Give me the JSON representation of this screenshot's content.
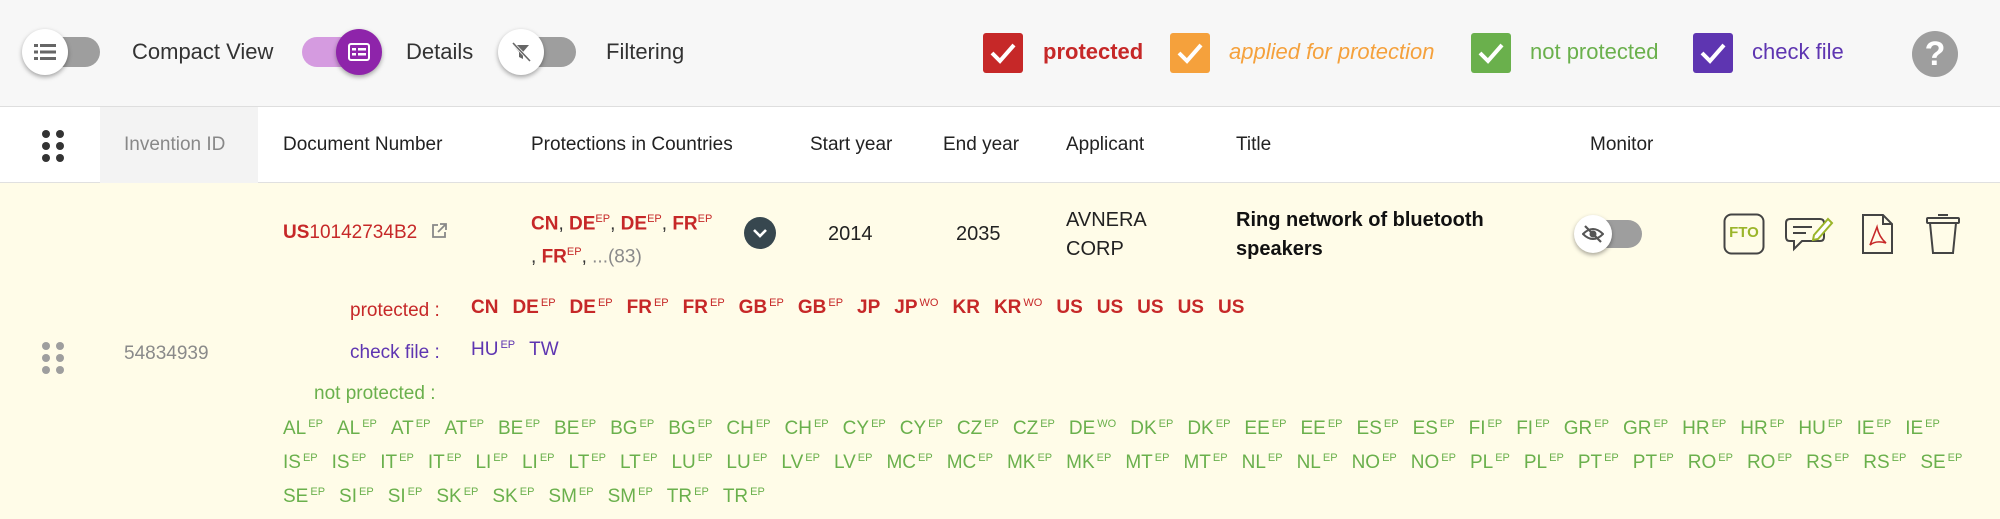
{
  "toolbar": {
    "compact_view_label": "Compact View",
    "details_label": "Details",
    "filtering_label": "Filtering",
    "legend": [
      {
        "label": "protected",
        "color": "#c62828"
      },
      {
        "label": "applied for protection",
        "color": "#f5a13c"
      },
      {
        "label": "not protected",
        "color": "#6ab04c"
      },
      {
        "label": "check file",
        "color": "#5e35b1"
      }
    ],
    "help_label": "?"
  },
  "columns": {
    "invention_id": "Invention ID",
    "document_number": "Document Number",
    "protections": "Protections in Countries",
    "start_year": "Start year",
    "end_year": "End year",
    "applicant": "Applicant",
    "title": "Title",
    "monitor": "Monitor"
  },
  "row": {
    "invention_id": "54834939",
    "doc_prefix": "US",
    "doc_number": "10142734B2",
    "summary": {
      "line1": [
        {
          "code": "CN",
          "sup": ""
        },
        {
          "code": "DE",
          "sup": "EP"
        },
        {
          "code": "DE",
          "sup": "EP"
        },
        {
          "code": "FR",
          "sup": "EP"
        }
      ],
      "line2": [
        {
          "code": "FR",
          "sup": "EP"
        }
      ],
      "more": "...(83)",
      "separator": ","
    },
    "start_year": "2014",
    "end_year": "2035",
    "applicant_line1": "AVNERA",
    "applicant_line2": "CORP",
    "title_line1": "Ring network of bluetooth",
    "title_line2": "speakers",
    "actions": {
      "fto": "FTO"
    },
    "protected_label": "protected :",
    "protected": [
      {
        "code": "CN",
        "sup": ""
      },
      {
        "code": "DE",
        "sup": "EP"
      },
      {
        "code": "DE",
        "sup": "EP"
      },
      {
        "code": "FR",
        "sup": "EP"
      },
      {
        "code": "FR",
        "sup": "EP"
      },
      {
        "code": "GB",
        "sup": "EP"
      },
      {
        "code": "GB",
        "sup": "EP"
      },
      {
        "code": "JP",
        "sup": ""
      },
      {
        "code": "JP",
        "sup": "WO"
      },
      {
        "code": "KR",
        "sup": ""
      },
      {
        "code": "KR",
        "sup": "WO"
      },
      {
        "code": "US",
        "sup": ""
      },
      {
        "code": "US",
        "sup": ""
      },
      {
        "code": "US",
        "sup": ""
      },
      {
        "code": "US",
        "sup": ""
      },
      {
        "code": "US",
        "sup": ""
      }
    ],
    "check_file_label": "check file :",
    "check_file": [
      {
        "code": "HU",
        "sup": "EP"
      },
      {
        "code": "TW",
        "sup": ""
      }
    ],
    "not_protected_label": "not protected :",
    "not_protected": [
      {
        "code": "AL",
        "sup": "EP"
      },
      {
        "code": "AL",
        "sup": "EP"
      },
      {
        "code": "AT",
        "sup": "EP"
      },
      {
        "code": "AT",
        "sup": "EP"
      },
      {
        "code": "BE",
        "sup": "EP"
      },
      {
        "code": "BE",
        "sup": "EP"
      },
      {
        "code": "BG",
        "sup": "EP"
      },
      {
        "code": "BG",
        "sup": "EP"
      },
      {
        "code": "CH",
        "sup": "EP"
      },
      {
        "code": "CH",
        "sup": "EP"
      },
      {
        "code": "CY",
        "sup": "EP"
      },
      {
        "code": "CY",
        "sup": "EP"
      },
      {
        "code": "CZ",
        "sup": "EP"
      },
      {
        "code": "CZ",
        "sup": "EP"
      },
      {
        "code": "DE",
        "sup": "WO"
      },
      {
        "code": "DK",
        "sup": "EP"
      },
      {
        "code": "DK",
        "sup": "EP"
      },
      {
        "code": "EE",
        "sup": "EP"
      },
      {
        "code": "EE",
        "sup": "EP"
      },
      {
        "code": "ES",
        "sup": "EP"
      },
      {
        "code": "ES",
        "sup": "EP"
      },
      {
        "code": "FI",
        "sup": "EP"
      },
      {
        "code": "FI",
        "sup": "EP"
      },
      {
        "code": "GR",
        "sup": "EP"
      },
      {
        "code": "GR",
        "sup": "EP"
      },
      {
        "code": "HR",
        "sup": "EP"
      },
      {
        "code": "HR",
        "sup": "EP"
      },
      {
        "code": "HU",
        "sup": "EP"
      },
      {
        "code": "IE",
        "sup": "EP"
      },
      {
        "code": "IE",
        "sup": "EP"
      },
      {
        "code": "IS",
        "sup": "EP"
      },
      {
        "code": "IS",
        "sup": "EP"
      },
      {
        "code": "IT",
        "sup": "EP"
      },
      {
        "code": "IT",
        "sup": "EP"
      },
      {
        "code": "LI",
        "sup": "EP"
      },
      {
        "code": "LI",
        "sup": "EP"
      },
      {
        "code": "LT",
        "sup": "EP"
      },
      {
        "code": "LT",
        "sup": "EP"
      },
      {
        "code": "LU",
        "sup": "EP"
      },
      {
        "code": "LU",
        "sup": "EP"
      },
      {
        "code": "LV",
        "sup": "EP"
      },
      {
        "code": "LV",
        "sup": "EP"
      },
      {
        "code": "MC",
        "sup": "EP"
      },
      {
        "code": "MC",
        "sup": "EP"
      },
      {
        "code": "MK",
        "sup": "EP"
      },
      {
        "code": "MK",
        "sup": "EP"
      },
      {
        "code": "MT",
        "sup": "EP"
      },
      {
        "code": "MT",
        "sup": "EP"
      },
      {
        "code": "NL",
        "sup": "EP"
      },
      {
        "code": "NL",
        "sup": "EP"
      },
      {
        "code": "NO",
        "sup": "EP"
      },
      {
        "code": "NO",
        "sup": "EP"
      },
      {
        "code": "PL",
        "sup": "EP"
      },
      {
        "code": "PL",
        "sup": "EP"
      },
      {
        "code": "PT",
        "sup": "EP"
      },
      {
        "code": "PT",
        "sup": "EP"
      },
      {
        "code": "RO",
        "sup": "EP"
      },
      {
        "code": "RO",
        "sup": "EP"
      },
      {
        "code": "RS",
        "sup": "EP"
      },
      {
        "code": "RS",
        "sup": "EP"
      },
      {
        "code": "SE",
        "sup": "EP"
      },
      {
        "code": "SE",
        "sup": "EP"
      },
      {
        "code": "SI",
        "sup": "EP"
      },
      {
        "code": "SI",
        "sup": "EP"
      },
      {
        "code": "SK",
        "sup": "EP"
      },
      {
        "code": "SK",
        "sup": "EP"
      },
      {
        "code": "SM",
        "sup": "EP"
      },
      {
        "code": "SM",
        "sup": "EP"
      },
      {
        "code": "TR",
        "sup": "EP"
      },
      {
        "code": "TR",
        "sup": "EP"
      }
    ]
  },
  "colors": {
    "protected": "#c62828",
    "check_file": "#5e35b1",
    "not_protected": "#6ab04c",
    "details_toggle": "#8e24aa",
    "row_background": "#fffce8"
  }
}
